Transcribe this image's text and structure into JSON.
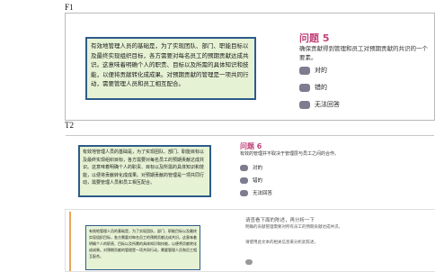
{
  "frames": [
    {
      "label": "F1",
      "info_text": "有效地管理人员的基础是，为了实现团队、部门、职能目标以及最终实现组织目标，各方需要对每名员工的预期贡献达成共识。这意味着明确个人的职责、目标以及所需的具体知识和技能，以便将贡献转化成成果。对预期贡献的管理是一项共同行动，需要管理人员和员工相互配合。",
      "question": {
        "title": "问题 5",
        "text": "确保贡献得到管理和员工对预期贡献的共识的一个要素。",
        "options": [
          "对的",
          "错的",
          "无法回答"
        ]
      }
    },
    {
      "label": "T2",
      "info_text": "有效地管理人员的基础是，为了实现团队、部门、职能目标以及最终实现组织目标，各方需要对每名员工的预期贡献达成共识。这意味着明确个人的职责、目标以及所需的具体知识和技能，以便将贡献转化成成果。对预期贡献的管理是一项共同行动，需要管理人员和员工相互配合。",
      "question": {
        "title": "问题 6",
        "text": "有效的管理并不取决于管理层与员工之间的合作。",
        "options": [
          "对的",
          "错的",
          "无法回答"
        ]
      }
    },
    {
      "label": "F3",
      "info_text": "有效地管理人员的基础是，为了实现团队、部门、职能目标以及最终实现组织目标，各方需要对每名员工的预期贡献达成共识。这意味着明确个人的职责、目标以及所需的具体知识和技能，以便将贡献转化成成果。对预期贡献的管理是一项共同行动，需要管理人员和员工相互配合。",
      "question": {
        "title": "请查看下面的陈述，再分析一下",
        "text": "明确的贡献管理需要对所有员工的预期贡献达成共识。",
        "text2": "请使用此文本的相关信息来分析此陈述。",
        "options": [
          ""
        ]
      }
    }
  ],
  "colors": {
    "accent": "#c0437a",
    "box_bg": "#e6f2d4",
    "box_border": "#2d5c8a",
    "radio": "#7d7d8f"
  }
}
